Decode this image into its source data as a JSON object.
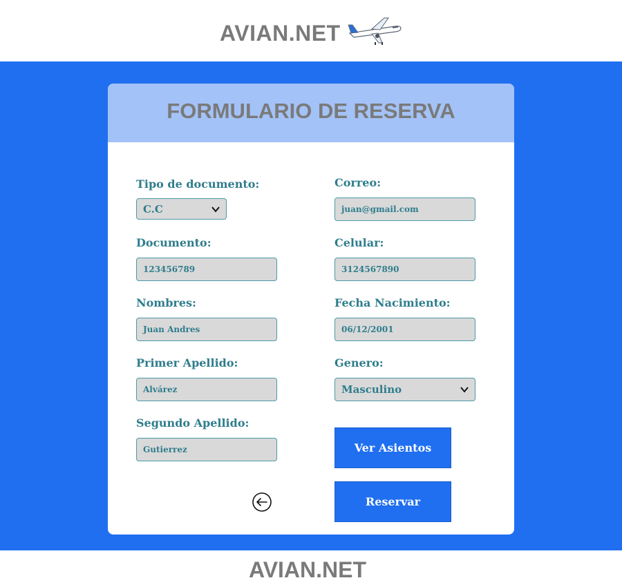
{
  "header": {
    "brand": "AVIAN.NET",
    "plane_icon": "airplane-icon"
  },
  "form": {
    "title": "FORMULARIO DE RESERVA",
    "tipo_documento": {
      "label": "Tipo de documento:",
      "value": "C.C"
    },
    "documento": {
      "label": "Documento:",
      "value": "123456789"
    },
    "nombres": {
      "label": "Nombres:",
      "value": "Juan Andres"
    },
    "primer_apellido": {
      "label": "Primer Apellido:",
      "value": "Alvárez"
    },
    "segundo_apellido": {
      "label": "Segundo Apellido:",
      "value": "Gutierrez"
    },
    "correo": {
      "label": "Correo:",
      "value": "juan@gmail.com"
    },
    "celular": {
      "label": "Celular:",
      "value": "3124567890"
    },
    "fecha_nacimiento": {
      "label": "Fecha Nacimiento:",
      "value": "06/12/2001"
    },
    "genero": {
      "label": "Genero:",
      "value": "Masculino"
    },
    "ver_asientos": "Ver Asientos",
    "reservar": "Reservar",
    "back_icon": "arrow-left-circle-icon"
  },
  "footer": {
    "brand": "AVIAN.NET"
  },
  "colors": {
    "primary": "#1f6ff0",
    "header_band": "#a3c2f7",
    "label": "#2f7d8c",
    "field_bg": "#d9d9d9",
    "brand_gray": "#7a7a7a"
  }
}
